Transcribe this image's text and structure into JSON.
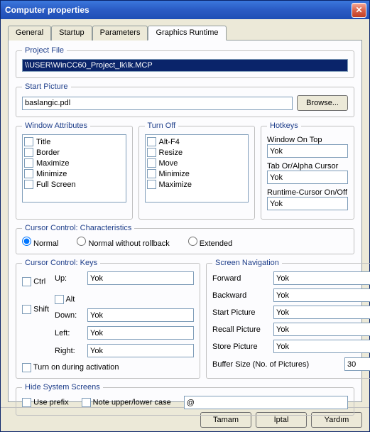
{
  "window": {
    "title": "Computer properties"
  },
  "tabs": [
    "General",
    "Startup",
    "Parameters",
    "Graphics Runtime"
  ],
  "active_tab": 3,
  "project_file": {
    "legend": "Project File",
    "value": "\\\\USER\\WinCC60_Project_lk\\lk.MCP"
  },
  "start_picture": {
    "legend": "Start Picture",
    "value": "baslangic.pdl",
    "browse": "Browse..."
  },
  "window_attributes": {
    "legend": "Window Attributes",
    "items": [
      "Title",
      "Border",
      "Maximize",
      "Minimize",
      "Full Screen"
    ]
  },
  "turn_off": {
    "legend": "Turn Off",
    "items": [
      "Alt-F4",
      "Resize",
      "Move",
      "Minimize",
      "Maximize"
    ]
  },
  "hotkeys": {
    "legend": "Hotkeys",
    "window_on_top_label": "Window On Top",
    "window_on_top": "Yok",
    "tab_alpha_label": "Tab Or/Alpha Cursor",
    "tab_alpha": "Yok",
    "runtime_cursor_label": "Runtime-Cursor On/Off",
    "runtime_cursor": "Yok"
  },
  "cursor_control_char": {
    "legend": "Cursor Control: Characteristics",
    "normal": "Normal",
    "normal_without": "Normal without rollback",
    "extended": "Extended"
  },
  "cursor_keys": {
    "legend": "Cursor Control: Keys",
    "ctrl": "Ctrl",
    "alt": "Alt",
    "shift": "Shift",
    "up_label": "Up:",
    "up": "Yok",
    "down_label": "Down:",
    "down": "Yok",
    "left_label": "Left:",
    "left": "Yok",
    "right_label": "Right:",
    "right": "Yok",
    "turn_on": "Turn on during activation"
  },
  "screen_nav": {
    "legend": "Screen Navigation",
    "forward_label": "Forward",
    "forward": "Yok",
    "backward_label": "Backward",
    "backward": "Yok",
    "start_label": "Start Picture",
    "start": "Yok",
    "recall_label": "Recall Picture",
    "recall": "Yok",
    "store_label": "Store Picture",
    "store": "Yok",
    "buffer_label": "Buffer Size (No. of Pictures)",
    "buffer": "30"
  },
  "hide_screens": {
    "legend": "Hide System Screens",
    "use_prefix": "Use prefix",
    "note_case": "Note upper/lower case",
    "value": "@"
  },
  "footer": {
    "ok": "Tamam",
    "cancel": "İptal",
    "help": "Yardım"
  }
}
